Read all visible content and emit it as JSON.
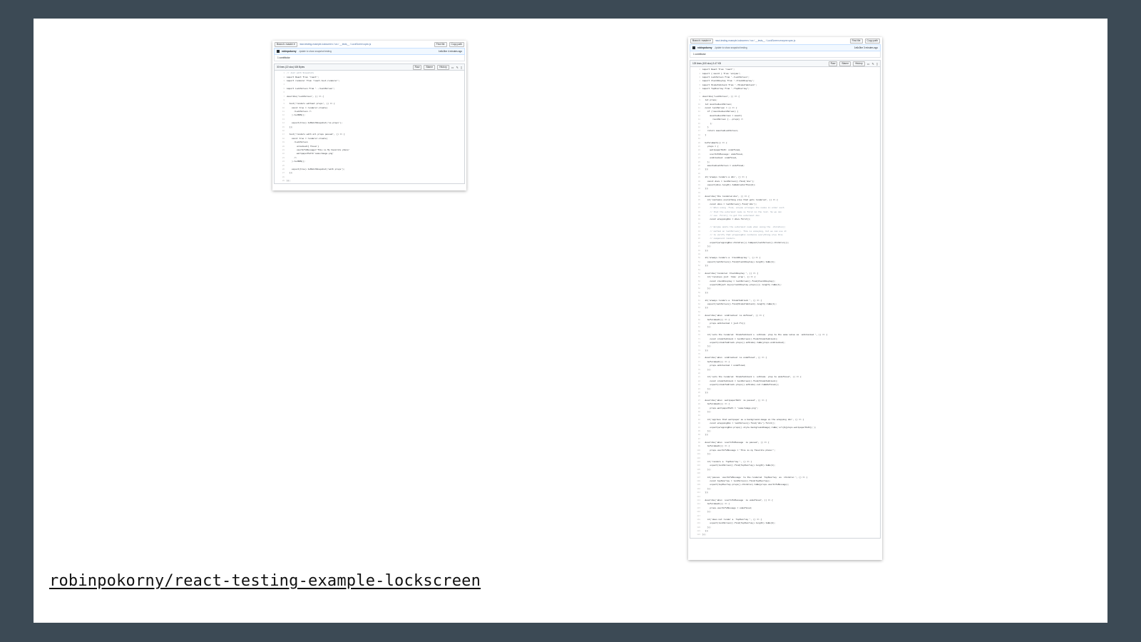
{
  "caption": "robinpokorny/react-testing-example-lockscreen",
  "left_shot": {
    "branch_button": "Branch: master ▾",
    "path": "react-testing-example-lockscreen / src / __tests__ / LockScreen.spec.js",
    "find_file": "Find file",
    "copy_path": "Copy path",
    "commit_author": "robinpokorny",
    "commit_message": "Update to show snapshot testing",
    "commit_meta": "1e6c0be  4 minutes ago",
    "contributors": "1 contributor",
    "file_info": "30 lines (22 sloc)   626 Bytes",
    "actions": [
      "Raw",
      "Blame",
      "History"
    ],
    "lines": [
      {
        "n": "1",
        "t": "// Jest with Snapshots",
        "c": true
      },
      {
        "n": "2",
        "t": "import React from 'react';"
      },
      {
        "n": "3",
        "t": "import renderer from 'react-test-renderer';"
      },
      {
        "n": "4",
        "t": ""
      },
      {
        "n": "5",
        "t": "import LockScreen from '../LockScreen';"
      },
      {
        "n": "6",
        "t": ""
      },
      {
        "n": "7",
        "t": "describe('LockScreen', () => {"
      },
      {
        "n": "8",
        "t": ""
      },
      {
        "n": "9",
        "t": "  test('renders without props', () => {"
      },
      {
        "n": "10",
        "t": "    const tree = renderer.create("
      },
      {
        "n": "11",
        "t": "      <LockScreen />"
      },
      {
        "n": "12",
        "t": "    ).toJSON();"
      },
      {
        "n": "13",
        "t": ""
      },
      {
        "n": "14",
        "t": "    expect(tree).toMatchSnapshot('no props');"
      },
      {
        "n": "15",
        "t": "  });"
      },
      {
        "n": "16",
        "t": ""
      },
      {
        "n": "17",
        "t": "  test('renders with all props passed', () => {"
      },
      {
        "n": "18",
        "t": "    const tree = renderer.create("
      },
      {
        "n": "19",
        "t": "      <LockScreen"
      },
      {
        "n": "20",
        "t": "        unlocked={ fixed }"
      },
      {
        "n": "21",
        "t": "        userInfoMessage='This is My Favorite phone'"
      },
      {
        "n": "22",
        "t": "        wallpaperPath='some/image.png'"
      },
      {
        "n": "23",
        "t": "      />"
      },
      {
        "n": "24",
        "t": "    ).toJSON();"
      },
      {
        "n": "25",
        "t": ""
      },
      {
        "n": "26",
        "t": "    expect(tree).toMatchSnapshot('with props');"
      },
      {
        "n": "27",
        "t": "  });"
      },
      {
        "n": "28",
        "t": ""
      },
      {
        "n": "29",
        "t": "});"
      }
    ]
  },
  "right_shot": {
    "branch_button": "Branch: master ▾",
    "path": "react-testing-example-lockscreen / src / __tests__ / LockScreen.enzyme.spec.js",
    "find_file": "Find file",
    "copy_path": "Copy path",
    "commit_author": "robinpokorny",
    "commit_message": "Update to show snapshot testing",
    "commit_meta": "1e6c0be  3 minutes ago",
    "contributors": "1 contributor",
    "file_info": "125 lines (100 sloc)   3.47 KB",
    "actions": [
      "Raw",
      "Blame",
      "History"
    ],
    "lines": [
      {
        "n": "1",
        "t": "import React from 'react';"
      },
      {
        "n": "2",
        "t": "import { mount } from 'enzyme';"
      },
      {
        "n": "3",
        "t": "import LockScreen from './LockScreen';"
      },
      {
        "n": "4",
        "t": "import ClockDisplay from './ClockDisplay';"
      },
      {
        "n": "5",
        "t": "import SlideToUnlock from './SlideToUnlock';"
      },
      {
        "n": "6",
        "t": "import TopOverlay from './TopOverlay';"
      },
      {
        "n": "7",
        "t": ""
      },
      {
        "n": "8",
        "t": "describe('LockScreen', () => {"
      },
      {
        "n": "9",
        "t": "  let props;"
      },
      {
        "n": "10",
        "t": "  let mountedLockScreen;"
      },
      {
        "n": "11",
        "t": "  const lockScreen = () => {"
      },
      {
        "n": "12",
        "t": "    if (!mountedLockScreen) {"
      },
      {
        "n": "13",
        "t": "      mountedLockScreen = mount("
      },
      {
        "n": "14",
        "t": "        <LockScreen {...props} />"
      },
      {
        "n": "15",
        "t": "      );"
      },
      {
        "n": "16",
        "t": "    }"
      },
      {
        "n": "17",
        "t": "    return mountedLockScreen;"
      },
      {
        "n": "18",
        "t": "  }"
      },
      {
        "n": "19",
        "t": ""
      },
      {
        "n": "20",
        "t": "  beforeEach(() => {"
      },
      {
        "n": "21",
        "t": "    props = {"
      },
      {
        "n": "22",
        "t": "      wallpaperPath: undefined,"
      },
      {
        "n": "23",
        "t": "      userInfoMessage: undefined,"
      },
      {
        "n": "24",
        "t": "      onUnlocked: undefined,"
      },
      {
        "n": "25",
        "t": "    };"
      },
      {
        "n": "26",
        "t": "    mountedLockScreen = undefined;"
      },
      {
        "n": "27",
        "t": "  });"
      },
      {
        "n": "28",
        "t": ""
      },
      {
        "n": "29",
        "t": "  it('always renders a div', () => {"
      },
      {
        "n": "30",
        "t": "    const divs = lockScreen().find('div');"
      },
      {
        "n": "31",
        "t": "    expect(divs.length).toBeGreaterThan(0);"
      },
      {
        "n": "32",
        "t": "  });"
      },
      {
        "n": "33",
        "t": ""
      },
      {
        "n": "34",
        "t": "  describe('the rendered div', () => {"
      },
      {
        "n": "35",
        "t": "    it('contains everything else that gets rendered', () => {"
      },
      {
        "n": "36",
        "t": "      const divs = lockScreen().find('div');"
      },
      {
        "n": "37",
        "t": "      // When using .find, enzyme arranges the nodes in order such",
        "c": true
      },
      {
        "n": "38",
        "t": "      // that the outermost node is first in the list. So we can",
        "c": true
      },
      {
        "n": "39",
        "t": "      // use .first() to get the outermost div.",
        "c": true
      },
      {
        "n": "40",
        "t": "      const wrappingDiv = divs.first();"
      },
      {
        "n": "41",
        "t": ""
      },
      {
        "n": "42",
        "t": "      // Enzyme omits the outermost node when using the .children()",
        "c": true
      },
      {
        "n": "43",
        "t": "      // method on lockScreen(). This is annoying, but we can use it",
        "c": true
      },
      {
        "n": "44",
        "t": "      // to verify that wrappingDiv contains everything else this",
        "c": true
      },
      {
        "n": "45",
        "t": "      // component renders.",
        "c": true
      },
      {
        "n": "46",
        "t": "      expect(wrappingDiv.children()).toEqual(lockScreen().children());"
      },
      {
        "n": "47",
        "t": "    });"
      },
      {
        "n": "48",
        "t": "  });"
      },
      {
        "n": "49",
        "t": ""
      },
      {
        "n": "50",
        "t": "  it('always renders a `ClockDisplay`', () => {"
      },
      {
        "n": "51",
        "t": "    expect(lockScreen().find(ClockDisplay).length).toBe(1);"
      },
      {
        "n": "52",
        "t": "  });"
      },
      {
        "n": "53",
        "t": ""
      },
      {
        "n": "54",
        "t": "  describe('rendered `ClockDisplay`', () => {"
      },
      {
        "n": "55",
        "t": "    it('receives just `time` prop', () => {"
      },
      {
        "n": "56",
        "t": "      const clockDisplay = lockScreen().find(ClockDisplay);"
      },
      {
        "n": "57",
        "t": "      expect(Object.keys(clockDisplay.props())).length).toBe(1);"
      },
      {
        "n": "58",
        "t": "    });"
      },
      {
        "n": "59",
        "t": "  });"
      },
      {
        "n": "60",
        "t": ""
      },
      {
        "n": "61",
        "t": "  it('always renders a `SlideToUnlock`', () => {"
      },
      {
        "n": "62",
        "t": "    expect(lockScreen().find(SlideToUnlock).length).toBe(1);"
      },
      {
        "n": "63",
        "t": "  });"
      },
      {
        "n": "64",
        "t": ""
      },
      {
        "n": "65",
        "t": "  describe('when `onUnlocked` is defined', () => {"
      },
      {
        "n": "66",
        "t": "    beforeEach(() => {"
      },
      {
        "n": "67",
        "t": "      props.onUnlocked = jest.fn();"
      },
      {
        "n": "68",
        "t": "    });"
      },
      {
        "n": "69",
        "t": ""
      },
      {
        "n": "70",
        "t": "    it('sets the rendered `SlideToUnlock`s `onSlide` prop to the same value as `onUnlocked`', () => {"
      },
      {
        "n": "71",
        "t": "      const slideToUnlock = lockScreen().find(SlideToUnlock);"
      },
      {
        "n": "72",
        "t": "      expect(slideToUnlock.props().onSlide).toBe(props.onUnlocked);"
      },
      {
        "n": "73",
        "t": "    });"
      },
      {
        "n": "74",
        "t": "  });"
      },
      {
        "n": "75",
        "t": ""
      },
      {
        "n": "76",
        "t": "  describe('when `onUnlocked` is undefined', () => {"
      },
      {
        "n": "77",
        "t": "    beforeEach(() => {"
      },
      {
        "n": "78",
        "t": "      props.onUnlocked = undefined;"
      },
      {
        "n": "79",
        "t": "    });"
      },
      {
        "n": "80",
        "t": ""
      },
      {
        "n": "81",
        "t": "    it('sets the rendered `SlideToUnlock`s `onSlide` prop to undefined', () => {"
      },
      {
        "n": "82",
        "t": "      const slideToUnlock = lockScreen().find(SlideToUnlock);"
      },
      {
        "n": "83",
        "t": "      expect(slideToUnlock.props().onSlide).not.toBeDefined();"
      },
      {
        "n": "84",
        "t": "    });"
      },
      {
        "n": "85",
        "t": "  });"
      },
      {
        "n": "86",
        "t": ""
      },
      {
        "n": "87",
        "t": "  describe('when `wallpaperPath` is passed', () => {"
      },
      {
        "n": "88",
        "t": "    beforeEach(() => {"
      },
      {
        "n": "89",
        "t": "      props.wallpaperPath = 'some/image.png';"
      },
      {
        "n": "90",
        "t": "    });"
      },
      {
        "n": "91",
        "t": ""
      },
      {
        "n": "92",
        "t": "    it('applies that wallpaper as a background-image on the wrapping div', () => {"
      },
      {
        "n": "93",
        "t": "      const wrappingDiv = lockScreen().find('div').first();"
      },
      {
        "n": "94",
        "t": "      expect(wrappingDiv.props().style.backgroundImage).toBe(`url(${props.wallpaperPath})`);"
      },
      {
        "n": "95",
        "t": "    });"
      },
      {
        "n": "96",
        "t": "  });"
      },
      {
        "n": "97",
        "t": ""
      },
      {
        "n": "98",
        "t": "  describe('when `userInfoMessage` is passed', () => {"
      },
      {
        "n": "99",
        "t": "    beforeEach(() => {"
      },
      {
        "n": "100",
        "t": "      props.userInfoMessage = 'This is my favorite phone!';"
      },
      {
        "n": "101",
        "t": "    });"
      },
      {
        "n": "102",
        "t": ""
      },
      {
        "n": "103",
        "t": "    it('renders a `TopOverlay`', () => {"
      },
      {
        "n": "104",
        "t": "      expect(lockScreen().find(TopOverlay).length).toBe(1);"
      },
      {
        "n": "105",
        "t": "    });"
      },
      {
        "n": "106",
        "t": ""
      },
      {
        "n": "107",
        "t": "    it('passes `userInfoMessage` to the rendered `TopOverlay` as `children`', () => {"
      },
      {
        "n": "108",
        "t": "      const topOverlay = lockScreen().find(TopOverlay);"
      },
      {
        "n": "109",
        "t": "      expect(topOverlay.props().children).toBe(props.userInfoMessage);"
      },
      {
        "n": "110",
        "t": "    });"
      },
      {
        "n": "111",
        "t": "  });"
      },
      {
        "n": "112",
        "t": ""
      },
      {
        "n": "113",
        "t": "  describe('when `userInfoMessage` is undefined', () => {"
      },
      {
        "n": "114",
        "t": "    beforeEach(() => {"
      },
      {
        "n": "115",
        "t": "      props.userInfoMessage = undefined;"
      },
      {
        "n": "116",
        "t": "    });"
      },
      {
        "n": "117",
        "t": ""
      },
      {
        "n": "118",
        "t": "    it('does not render a `TopOverlay`', () => {"
      },
      {
        "n": "119",
        "t": "      expect(lockScreen().find(TopOverlay).length).toBe(0);"
      },
      {
        "n": "120",
        "t": "    });"
      },
      {
        "n": "121",
        "t": "  });"
      },
      {
        "n": "122",
        "t": "});"
      }
    ]
  }
}
